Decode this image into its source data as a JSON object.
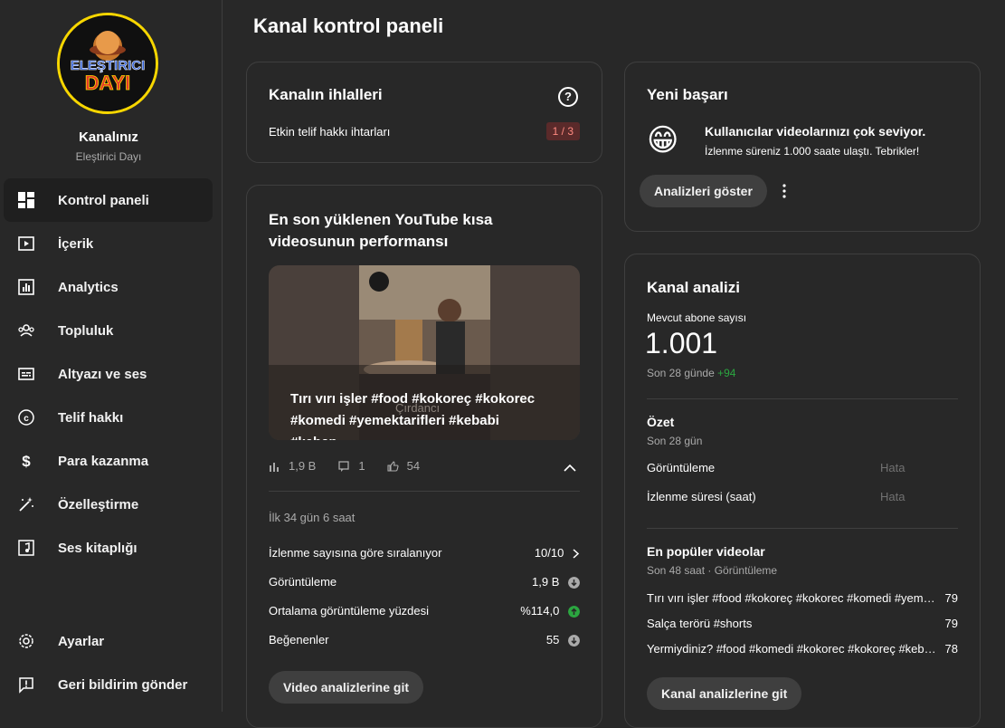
{
  "sidebar": {
    "channel_title": "Kanalınız",
    "channel_name": "Eleştirici Dayı",
    "logo_text_top": "ELEŞTIRICI",
    "logo_text_bottom": "DAYI",
    "items": [
      {
        "label": "Kontrol paneli",
        "icon": "dashboard-icon",
        "active": true
      },
      {
        "label": "İçerik",
        "icon": "content-icon"
      },
      {
        "label": "Analytics",
        "icon": "analytics-icon"
      },
      {
        "label": "Topluluk",
        "icon": "community-icon"
      },
      {
        "label": "Altyazı ve ses",
        "icon": "subtitles-icon"
      },
      {
        "label": "Telif hakkı",
        "icon": "copyright-icon"
      },
      {
        "label": "Para kazanma",
        "icon": "dollar-icon"
      },
      {
        "label": "Özelleştirme",
        "icon": "magic-wand-icon"
      },
      {
        "label": "Ses kitaplığı",
        "icon": "music-library-icon"
      }
    ],
    "bottom_items": [
      {
        "label": "Ayarlar",
        "icon": "gear-icon"
      },
      {
        "label": "Geri bildirim gönder",
        "icon": "feedback-icon"
      }
    ]
  },
  "page": {
    "title": "Kanal kontrol paneli"
  },
  "violations": {
    "title": "Kanalın ihlalleri",
    "label": "Etkin telif hakkı ihtarları",
    "badge": "1 / 3"
  },
  "shorts": {
    "title": "En son yüklenen YouTube kısa videosunun performansı",
    "video_title": "Tırı vırı işler #food #kokoreç #kokorec #komedi #yemektarifleri #kebabi #kebap…",
    "thumb_caption": "Çırdancı",
    "views": "1,9 B",
    "comments": "1",
    "likes": "54",
    "period": "İlk 34 gün 6 saat",
    "rows": [
      {
        "label": "İzlenme sayısına göre sıralanıyor",
        "value": "10/10"
      },
      {
        "label": "Görüntüleme",
        "value": "1,9 B"
      },
      {
        "label": "Ortalama görüntüleme yüzdesi",
        "value": "%114,0"
      },
      {
        "label": "Beğenenler",
        "value": "55"
      }
    ],
    "button": "Video analizlerine git"
  },
  "achievement": {
    "title": "Yeni başarı",
    "headline": "Kullanıcılar videolarınızı çok seviyor.",
    "text": "İzlenme süreniz 1.000 saate ulaştı. Tebrikler!",
    "button": "Analizleri göster",
    "emoji": "😁"
  },
  "analytics": {
    "title": "Kanal analizi",
    "subs_label": "Mevcut abone sayısı",
    "subs_value": "1.001",
    "period_prefix": "Son 28 günde",
    "period_delta": "+94",
    "summary_title": "Özet",
    "summary_period": "Son 28 gün",
    "summary_rows": [
      {
        "label": "Görüntüleme",
        "value": "Hata"
      },
      {
        "label": "İzlenme süresi (saat)",
        "value": "Hata"
      }
    ],
    "top_title": "En popüler videolar",
    "top_period": "Son 48 saat · Görüntüleme",
    "top_videos": [
      {
        "title": "Tırı vırı işler #food #kokoreç #kokorec #komedi #yem…",
        "value": "79"
      },
      {
        "title": "Salça terörü #shorts",
        "value": "79"
      },
      {
        "title": "Yermiydiniz? #food #komedi #kokorec #kokoreç #keb…",
        "value": "78"
      }
    ],
    "button": "Kanal analizlerine git"
  },
  "colors": {
    "badge_bg": "#5a2a2a",
    "badge_text": "#ff8a80",
    "positive": "#2ba640",
    "down_icon": "#aaaaaa"
  }
}
